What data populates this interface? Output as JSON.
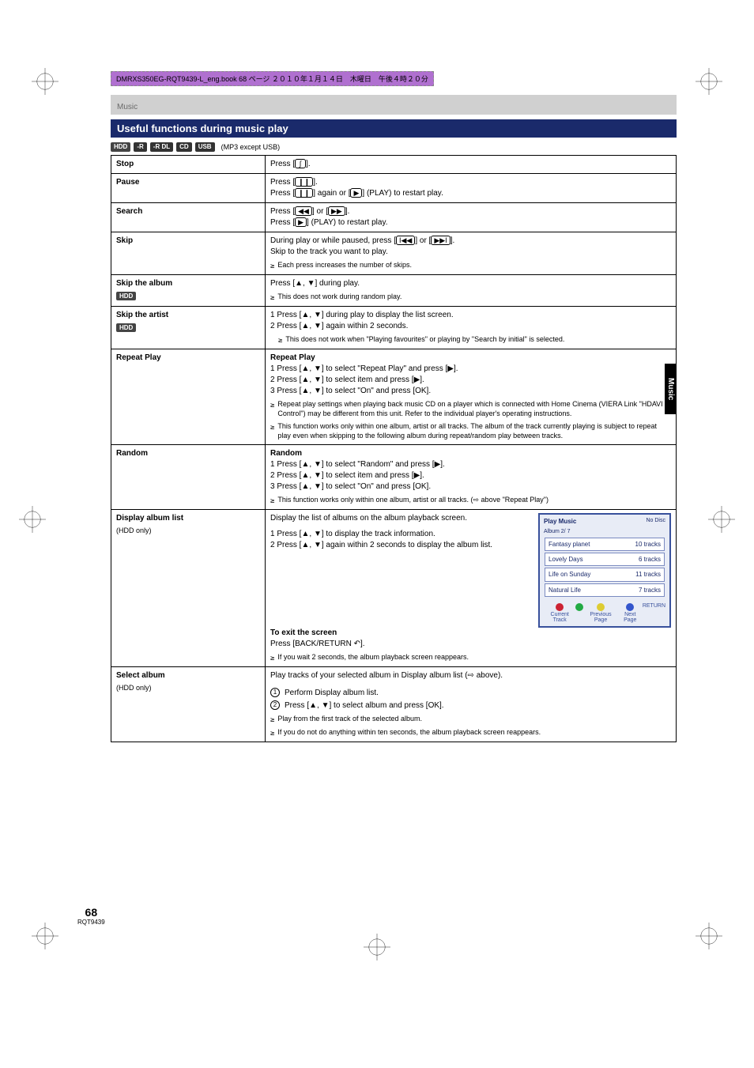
{
  "header_note": "DMRXS350EG-RQT9439-L_eng.book  68 ページ  ２０１０年１月１４日　木曜日　午後４時２０分",
  "top_category": "Music",
  "title_bar": "Useful functions during music play",
  "disc_tags": [
    "HDD",
    "-R",
    "-R DL",
    "CD",
    "USB"
  ],
  "cond_text": "(MP3 except USB)",
  "rows": [
    {
      "label": "Stop",
      "content": "Press [∫].",
      "content_parts": [
        "Press [",
        "∫",
        "]."
      ]
    },
    {
      "label": "Pause",
      "content_lines": [
        {
          "parts": [
            "Press [",
            "❙❙",
            "]."
          ]
        },
        {
          "parts": [
            "Press [",
            "❙❙",
            "] again or [",
            "▶",
            "] (PLAY) to restart play."
          ]
        }
      ]
    },
    {
      "label": "Search",
      "content_lines": [
        {
          "parts": [
            "Press [",
            "◀◀",
            "] or [",
            "▶▶",
            "]."
          ]
        },
        {
          "parts": [
            "Press [",
            "▶",
            "] (PLAY) to restart play."
          ]
        }
      ]
    },
    {
      "label": "Skip",
      "content_lines": [
        {
          "parts": [
            "During play or while paused, press [",
            "I◀◀",
            "] or [",
            "▶▶I",
            "]."
          ]
        },
        {
          "plain": "Skip to the track you want to play."
        }
      ],
      "bullets": [
        "Each press increases the number of skips."
      ]
    },
    {
      "label": "Skip the album",
      "label_sub": "HDD",
      "content_lines": [
        {
          "parts": [
            "Press [",
            "▲",
            ", ",
            "▼",
            "] during play."
          ]
        }
      ],
      "bullets": [
        "This does not work during random play."
      ]
    },
    {
      "label": "Skip the artist",
      "label_sub": "HDD",
      "content_lines": [
        {
          "parts": [
            "1 Press [",
            "▲",
            ", ",
            "▼",
            "] during play to display the list screen."
          ]
        },
        {
          "parts": [
            "2 Press [",
            "▲",
            ", ",
            "▼",
            "] again within 2 seconds."
          ]
        }
      ],
      "sub_bullets": [
        "This does not work when \"Playing favourites\" or playing by \"Search by initial\" is selected."
      ]
    },
    {
      "label": "Repeat Play",
      "sublabel": "Repeat Play",
      "content_lines": [
        {
          "parts": [
            "1 Press [",
            "▲",
            ", ",
            "▼",
            "] to select \"Repeat Play\" and press [",
            "▶",
            "]."
          ]
        },
        {
          "parts": [
            "2 Press [",
            "▲",
            ", ",
            "▼",
            "] to select item and press [",
            "▶",
            "]."
          ]
        },
        {
          "parts": [
            "3 Press [",
            "▲",
            ", ",
            "▼",
            "] to select \"On\" and press [OK]."
          ]
        }
      ],
      "bullets": [
        "Repeat play settings when playing back music CD on a player which is connected with Home Cinema (VIERA Link \"HDAVI Control\") may be different from this unit. Refer to the individual player's operating instructions.",
        "This function works only within one album, artist or all tracks. The album of the track currently playing is subject to repeat play even when skipping to the following album during repeat/random play between tracks."
      ]
    },
    {
      "label": "Random",
      "sublabel": "Random",
      "content_lines": [
        {
          "parts": [
            "1 Press [",
            "▲",
            ", ",
            "▼",
            "] to select \"Random\" and press [",
            "▶",
            "]."
          ]
        },
        {
          "parts": [
            "2 Press [",
            "▲",
            ", ",
            "▼",
            "] to select item and press [",
            "▶",
            "]."
          ]
        },
        {
          "parts": [
            "3 Press [",
            "▲",
            ", ",
            "▼",
            "] to select \"On\" and press [OK]."
          ]
        }
      ],
      "bullets": [
        "This function works only within one album, artist or all tracks. (⇨ above \"Repeat Play\")"
      ]
    },
    {
      "label": "Display album list",
      "sublabel": "(HDD only)",
      "pre_text": "Display the list of albums on the album playback screen.",
      "content_lines": [
        {
          "parts": [
            "1 Press [",
            "▲",
            ", ",
            "▼",
            "] to display the track information."
          ]
        },
        {
          "parts": [
            "2 Press [",
            "▲",
            ", ",
            "▼",
            "] again within 2 seconds to display the album list."
          ]
        }
      ],
      "screen": true,
      "after_dash": "—",
      "after_text_label": "To exit the screen",
      "after_text_body": "Press [BACK/RETURN ↶].",
      "bullets": [
        "If you wait 2 seconds, the album playback screen reappears."
      ]
    },
    {
      "label": "Select album",
      "sublabel": "(HDD only)",
      "pre_text": "Play tracks of your selected album in Display album list (⇨ above).",
      "steps": [
        {
          "num": "1",
          "text": "Perform Display album list."
        },
        {
          "num": "2",
          "parts": [
            "Press [",
            "▲",
            ", ",
            "▼",
            "] to select album and press [OK]."
          ]
        }
      ],
      "bullets": [
        "Play from the first track of the selected album.",
        "If you do not do anything within ten seconds, the album playback screen reappears."
      ]
    }
  ],
  "screen_box": {
    "title": "Play Music",
    "count_label": "Album 2/ 7",
    "rows": [
      {
        "name": "Fantasy planet",
        "count": "10 tracks"
      },
      {
        "name": "Lovely Days",
        "count": "6 tracks"
      },
      {
        "name": "Life on Sunday",
        "count": "11 tracks"
      },
      {
        "name": "Natural Life",
        "count": "7 tracks"
      }
    ],
    "footer": [
      {
        "color": "red",
        "label": "Current\nTrack"
      },
      {
        "color": "green",
        "label": ""
      },
      {
        "color": "yellow",
        "label": "Previous\nPage"
      },
      {
        "color": "blue",
        "label": "Next\nPage"
      }
    ],
    "return_text": "RETURN",
    "disc_text": "No Disc"
  },
  "side_tab": "Music",
  "page_number": "68",
  "page_code": "RQT9439"
}
